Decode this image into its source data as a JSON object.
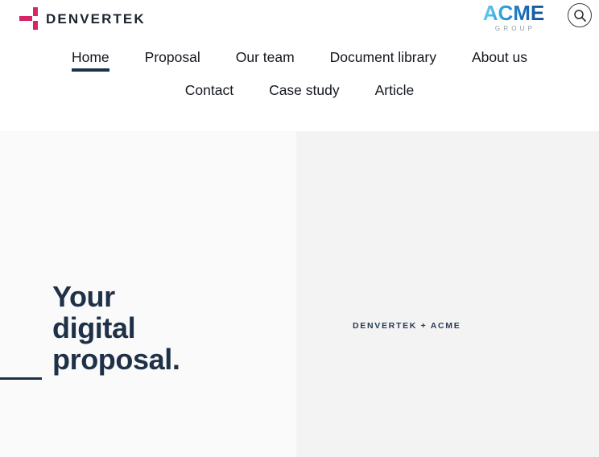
{
  "brand": {
    "name": "DENVERTEK",
    "mark_color": "#d8256a",
    "word_color": "#1d2430"
  },
  "partner_logo": {
    "name": "ACME",
    "subtitle": "GROUP",
    "gradient_from": "#6fd0ef",
    "gradient_to": "#144f8e",
    "subtitle_color": "#8f9aa5"
  },
  "search": {
    "icon": "search-icon",
    "label": "Search"
  },
  "nav": {
    "row1": [
      {
        "label": "Home",
        "active": true
      },
      {
        "label": "Proposal",
        "active": false
      },
      {
        "label": "Our team",
        "active": false
      },
      {
        "label": "Document library",
        "active": false
      },
      {
        "label": "About us",
        "active": false
      }
    ],
    "row2": [
      {
        "label": "Contact",
        "active": false
      },
      {
        "label": "Case study",
        "active": false
      },
      {
        "label": "Article",
        "active": false
      }
    ],
    "active_underline_color": "#1b3349"
  },
  "hero": {
    "title_lines": [
      "Your",
      "digital",
      "proposal."
    ],
    "title_color": "#1f3147",
    "left_bg": "#fafafb",
    "right_bg": "#f3f3f4",
    "badge": "DENVERTEK + ACME",
    "badge_color": "#2a3b52"
  }
}
